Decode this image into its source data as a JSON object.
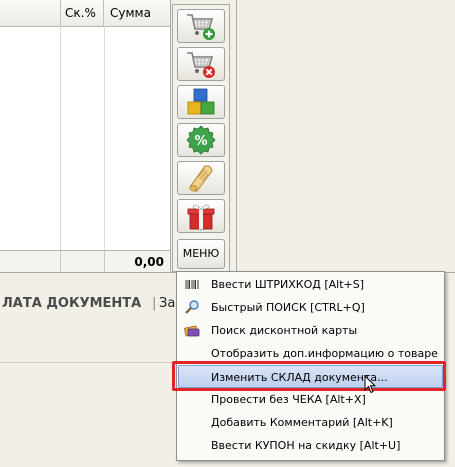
{
  "table": {
    "columns": [
      "",
      "Ск.%",
      "Сумма"
    ],
    "total": "0,00"
  },
  "toolbar": {
    "buttons": [
      {
        "name": "cart-add-icon"
      },
      {
        "name": "cart-remove-icon"
      },
      {
        "name": "blocks-icon"
      },
      {
        "name": "discount-percent-icon"
      },
      {
        "name": "scroll-icon"
      },
      {
        "name": "gift-icon"
      }
    ],
    "menu_label": "МЕНЮ"
  },
  "document": {
    "payment_label": "ЛАТА ДОКУМЕНТА",
    "partial_label": "За"
  },
  "context_menu": {
    "items": [
      {
        "label": "Ввести ШТРИХКОД [Alt+S]",
        "icon": "barcode-icon"
      },
      {
        "label": "Быстрый ПОИСК  [CTRL+Q]",
        "icon": "magnifier-icon"
      },
      {
        "label": "Поиск дисконтной карты",
        "icon": "discount-card-icon"
      },
      {
        "label": "Отобразить доп.информацию о товаре",
        "icon": ""
      },
      {
        "label": "Изменить СКЛАД документа...",
        "icon": ""
      },
      {
        "label": "Провести без ЧЕКА [Alt+X]",
        "icon": ""
      },
      {
        "label": "Добавить Комментарий [Alt+K]",
        "icon": ""
      },
      {
        "label": "Ввести КУПОН на скидку [Alt+U]",
        "icon": ""
      }
    ],
    "highlighted_index": 4
  },
  "colors": {
    "highlight": "#bcd0ef",
    "red_frame": "#e42525"
  }
}
